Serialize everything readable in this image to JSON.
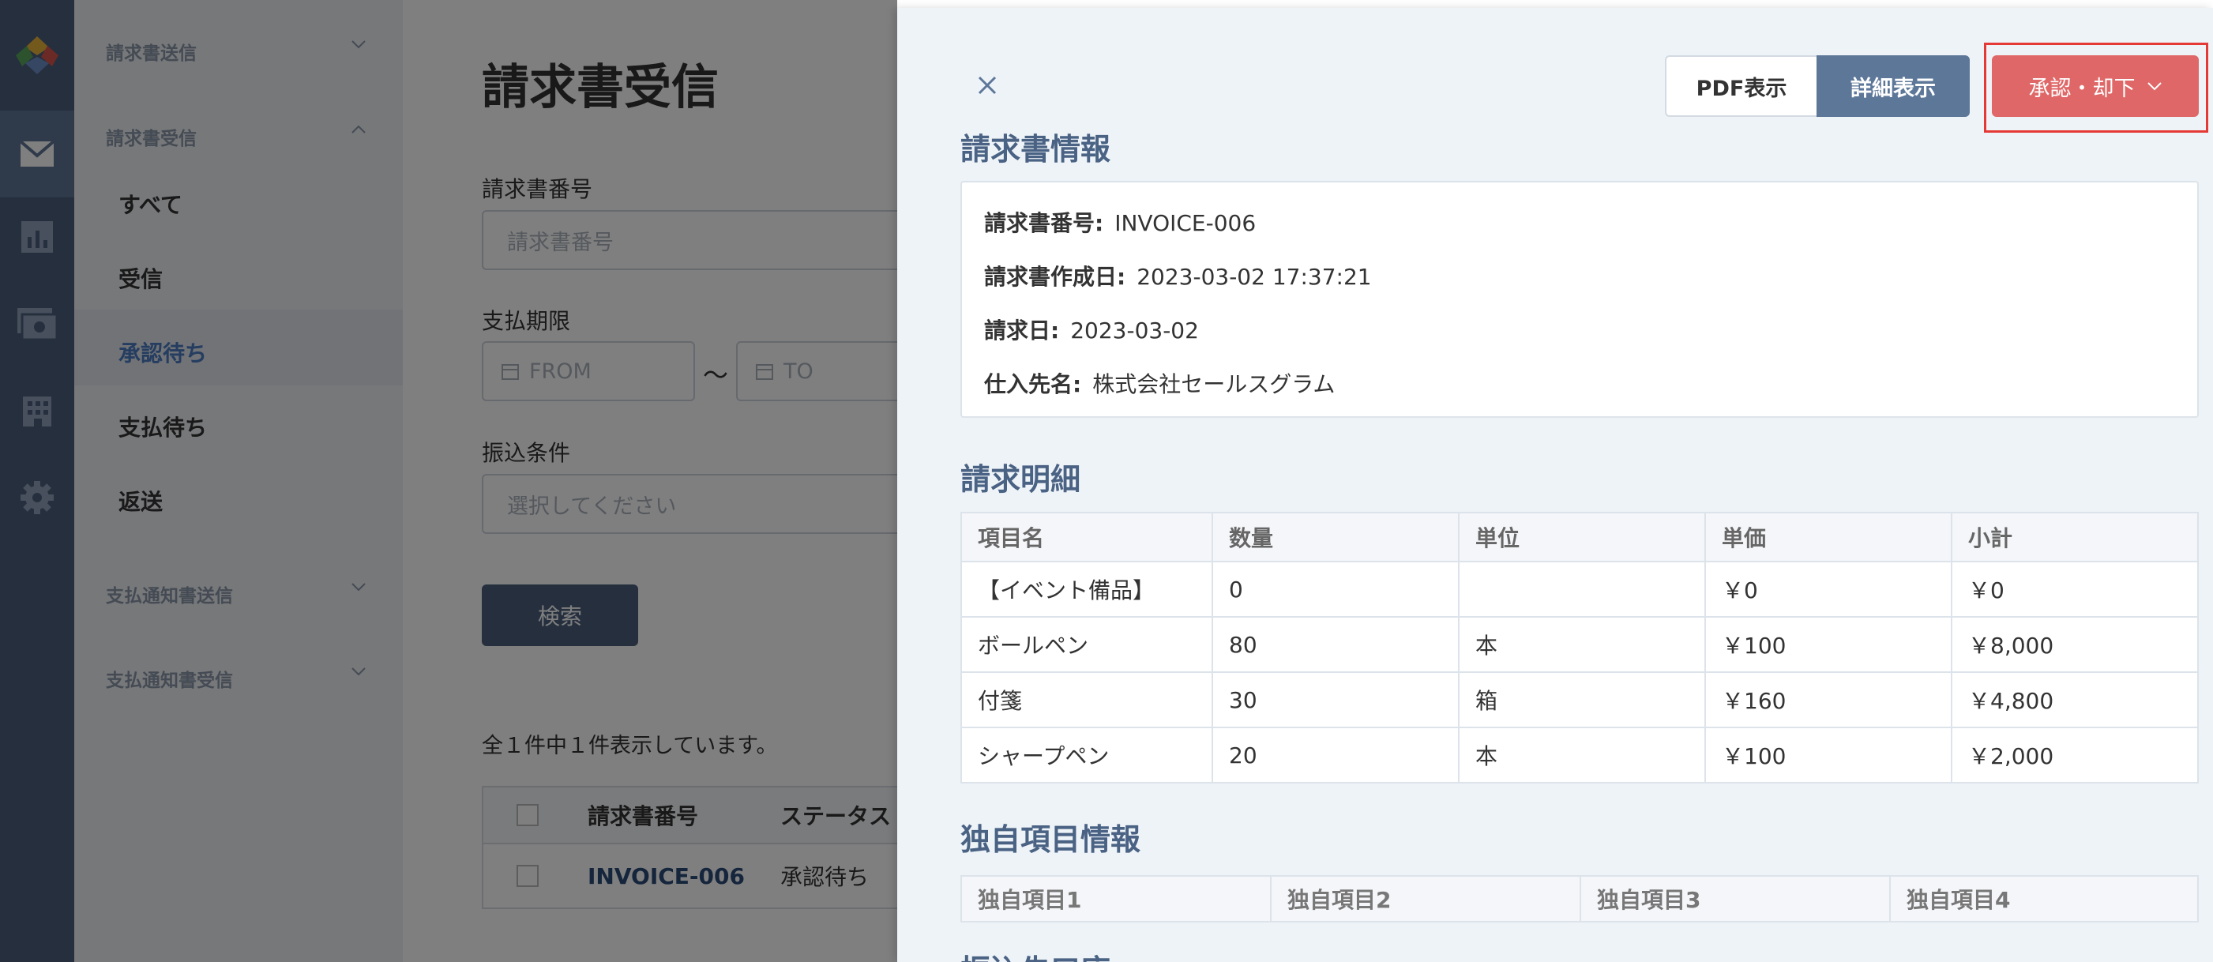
{
  "sidebar": {
    "groups": [
      "請求書送信",
      "請求書受信",
      "支払通知書送信",
      "支払通知書受信"
    ],
    "items": [
      "すべて",
      "受信",
      "承認待ち",
      "支払待ち",
      "返送"
    ]
  },
  "main": {
    "title": "請求書受信",
    "invoice_no_label": "請求書番号",
    "invoice_no_placeholder": "請求書番号",
    "due_label": "支払期限",
    "from_placeholder": "FROM",
    "range_sep": "〜",
    "to_placeholder": "TO",
    "transfer_label": "振込条件",
    "transfer_placeholder": "選択してください",
    "search_label": "検索",
    "count_text": "全１件中１件表示しています。",
    "table_headers": [
      "請求書番号",
      "ステータス"
    ],
    "table_row": {
      "invoice": "INVOICE-006",
      "status": "承認待ち"
    }
  },
  "drawer": {
    "pdf_label": "PDF表示",
    "detail_label": "詳細表示",
    "approve_label": "承認・却下",
    "info_title": "請求書情報",
    "info": [
      {
        "label": "請求書番号:",
        "value": "INVOICE-006"
      },
      {
        "label": "請求書作成日:",
        "value": "2023-03-02 17:37:21"
      },
      {
        "label": "請求日:",
        "value": "2023-03-02"
      },
      {
        "label": "仕入先名:",
        "value": "株式会社セールスグラム"
      }
    ],
    "detail_title": "請求明細",
    "detail_headers": [
      "項目名",
      "数量",
      "単位",
      "単価",
      "小計"
    ],
    "detail_rows": [
      [
        "【イベント備品】",
        "0",
        "",
        "￥0",
        "￥0"
      ],
      [
        "ボールペン",
        "80",
        "本",
        "￥100",
        "￥8,000"
      ],
      [
        "付箋",
        "30",
        "箱",
        "￥160",
        "￥4,800"
      ],
      [
        "シャープペン",
        "20",
        "本",
        "￥100",
        "￥2,000"
      ]
    ],
    "custom_title": "独自項目情報",
    "custom_headers": [
      "独自項目1",
      "独自項目2",
      "独自項目3",
      "独自項目4"
    ],
    "next_title": "振込先口座"
  },
  "colors": {
    "accent": "#4a6283",
    "approve": "#e06767",
    "highlight": "#e53935"
  }
}
